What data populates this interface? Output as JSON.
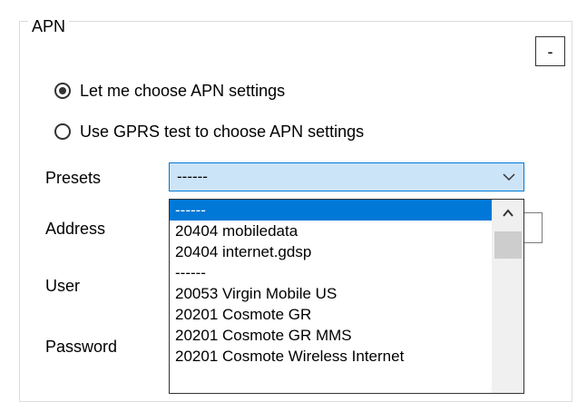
{
  "group": {
    "title": "APN",
    "collapse_label": "-"
  },
  "radios": [
    {
      "label": "Let me choose APN settings",
      "checked": true
    },
    {
      "label": "Use GPRS test to choose APN settings",
      "checked": false
    }
  ],
  "fields": {
    "presets_label": "Presets",
    "address_label": "Address",
    "user_label": "User",
    "password_label": "Password"
  },
  "presets": {
    "selected_value": "------",
    "options": [
      "------",
      "20404 mobiledata",
      "20404 internet.gdsp",
      "------",
      "20053 Virgin Mobile US",
      "20201 Cosmote GR",
      "20201 Cosmote GR MMS",
      "20201 Cosmote Wireless Internet"
    ],
    "highlighted_index": 0
  },
  "icons": {
    "combo_arrow": "chevron-down-icon",
    "scroll_up": "chevron-up-icon"
  },
  "colors": {
    "selection": "#0078d7",
    "combo_background": "#cce4f7"
  }
}
